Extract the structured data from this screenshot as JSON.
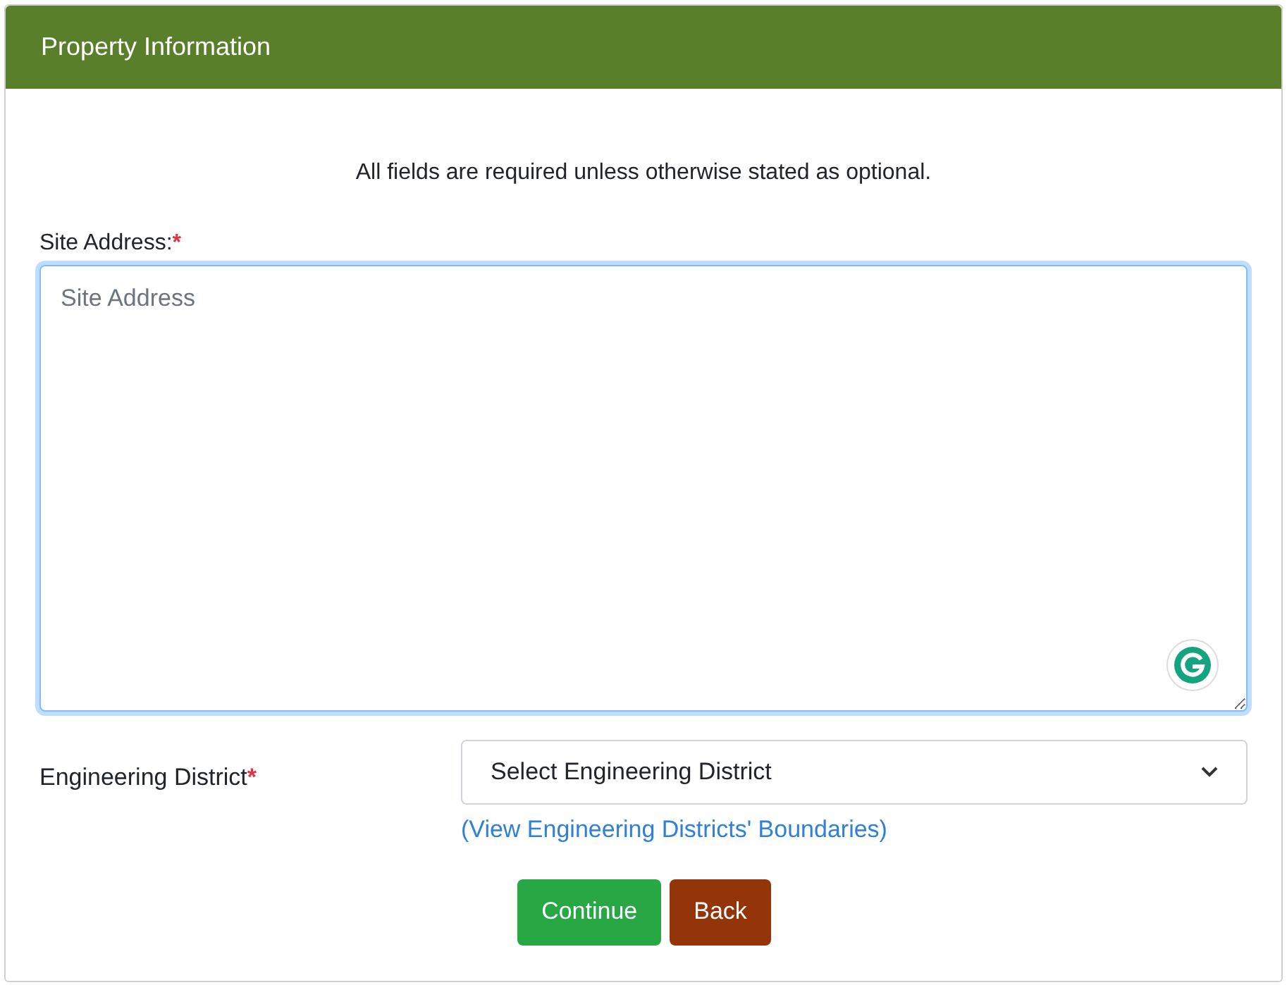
{
  "header": {
    "title": "Property Information"
  },
  "instruction": "All fields are required unless otherwise stated as optional.",
  "site_address": {
    "label": "Site Address:",
    "marker": "*",
    "placeholder": "Site Address",
    "focused": true
  },
  "district": {
    "label": "Engineering District",
    "marker": "*",
    "value": "Select Engineering District",
    "link": "(View Engineering Districts' Boundaries)"
  },
  "buttons": [
    {
      "label": "Continue",
      "kind": "primary"
    },
    {
      "label": "Back",
      "kind": "secondary"
    }
  ]
}
